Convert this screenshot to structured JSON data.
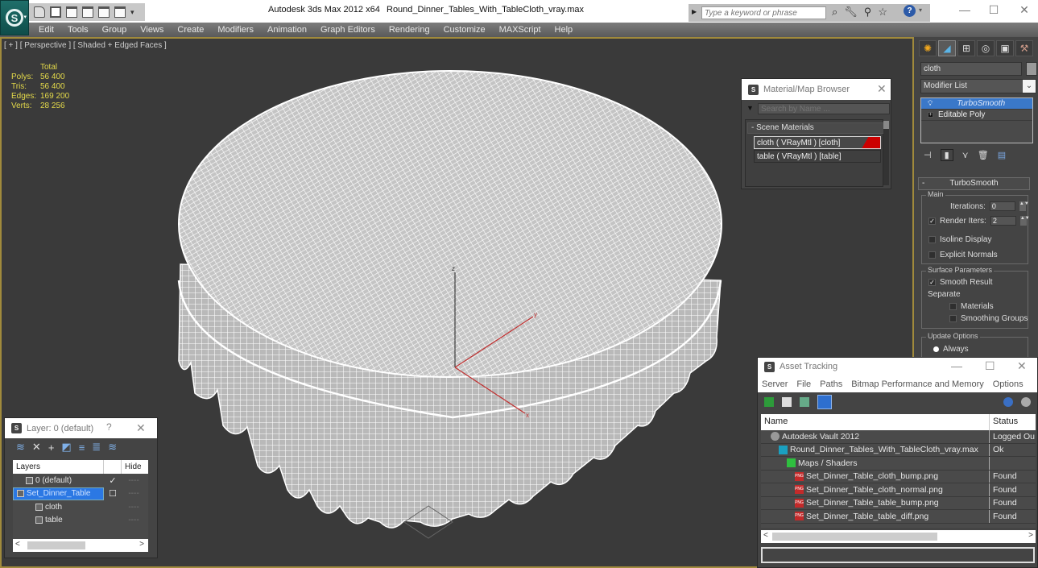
{
  "window": {
    "app_title": "Autodesk 3ds Max  2012 x64",
    "file_title": "Round_Dinner_Tables_With_TableCloth_vray.max",
    "search_placeholder": "Type a keyword or phrase",
    "app_button_icon": "3dsmax-logo-icon",
    "quick_access_icons": [
      "new-scene-icon",
      "open-file-icon",
      "save-file-icon",
      "undo-icon",
      "redo-icon",
      "project-folder-icon",
      "customize-dropdown-icon"
    ],
    "search_icons": [
      "binoculars-icon",
      "wrench-icon",
      "satellite-icon",
      "star-icon"
    ],
    "help_label": "?",
    "controls": {
      "minimize": "—",
      "maximize": "☐",
      "close": "✕"
    }
  },
  "menubar": [
    "Edit",
    "Tools",
    "Group",
    "Views",
    "Create",
    "Modifiers",
    "Animation",
    "Graph Editors",
    "Rendering",
    "Customize",
    "MAXScript",
    "Help"
  ],
  "viewport": {
    "label": "[ + ] [ Perspective ] [ Shaded + Edged Faces ]",
    "stats": {
      "header": "Total",
      "rows": [
        {
          "k": "Polys:",
          "v": "56 400"
        },
        {
          "k": "Tris:",
          "v": "56 400"
        },
        {
          "k": "Edges:",
          "v": "169 200"
        },
        {
          "k": "Verts:",
          "v": "28 256"
        }
      ]
    },
    "gizmo": {
      "z": "z",
      "y": "y",
      "x": "x"
    }
  },
  "command_panel": {
    "tabs": [
      "create-icon",
      "modify-icon",
      "hierarchy-icon",
      "motion-icon",
      "display-icon",
      "utilities-icon"
    ],
    "active_tab": 1,
    "object_name": "cloth",
    "modifier_list": "Modifier List",
    "stack": [
      {
        "label": "TurboSmooth",
        "selected": true
      },
      {
        "label": "Editable Poly",
        "selected": false
      }
    ],
    "stack_tools": [
      "pin-stack-icon",
      "show-end-result-icon",
      "make-unique-icon",
      "remove-modifier-icon",
      "configure-sets-icon"
    ],
    "turbosmooth": {
      "title": "TurboSmooth",
      "collapse": "-",
      "main_group": "Main",
      "iterations_label": "Iterations:",
      "iterations_value": "0",
      "render_iters_label": "Render Iters:",
      "render_iters_value": "2",
      "render_iters_checked": true,
      "isoline_label": "Isoline Display",
      "isoline_checked": false,
      "explicit_normals_label": "Explicit Normals",
      "explicit_normals_checked": false,
      "surface_group": "Surface Parameters",
      "smooth_result_label": "Smooth Result",
      "smooth_result_checked": true,
      "separate_label": "Separate",
      "materials_label": "Materials",
      "materials_checked": false,
      "smoothing_groups_label": "Smoothing Groups",
      "smoothing_groups_checked": false,
      "update_group": "Update Options",
      "always_label": "Always"
    }
  },
  "material_browser": {
    "title": "Material/Map Browser",
    "search_placeholder": "Search by Name ...",
    "group": "- Scene Materials",
    "items": [
      {
        "label": "cloth  ( VRayMtl ) [cloth]",
        "selected": true,
        "swatch": "#cc0000"
      },
      {
        "label": "table  ( VRayMtl ) [table]",
        "selected": false
      }
    ]
  },
  "asset_tracking": {
    "title": "Asset Tracking",
    "menu": [
      "Server",
      "File",
      "Paths",
      "Bitmap Performance and Memory",
      "Options"
    ],
    "columns": [
      "Name",
      "Status"
    ],
    "rows": [
      {
        "name": "Autodesk Vault 2012",
        "status": "Logged Ou",
        "icon": "vault",
        "indent": 1
      },
      {
        "name": "Round_Dinner_Tables_With_TableCloth_vray.max",
        "status": "Ok",
        "icon": "max",
        "indent": 2
      },
      {
        "name": "Maps / Shaders",
        "status": "",
        "icon": "maps",
        "indent": 3
      },
      {
        "name": "Set_Dinner_Table_cloth_bump.png",
        "status": "Found",
        "icon": "png",
        "indent": 4
      },
      {
        "name": "Set_Dinner_Table_cloth_normal.png",
        "status": "Found",
        "icon": "png",
        "indent": 4
      },
      {
        "name": "Set_Dinner_Table_table_bump.png",
        "status": "Found",
        "icon": "png",
        "indent": 4
      },
      {
        "name": "Set_Dinner_Table_table_diff.png",
        "status": "Found",
        "icon": "png",
        "indent": 4
      }
    ],
    "png_badge": "PNG"
  },
  "layer_manager": {
    "title": "Layer: 0 (default)",
    "help": "?",
    "close": "✕",
    "toolbar": [
      "create-layer-icon",
      "delete-layer-icon",
      "add-to-layer-icon",
      "select-objects-icon",
      "highlight-layer-icon",
      "hide-all-icon",
      "freeze-all-icon"
    ],
    "columns": [
      "Layers",
      "",
      "Hide"
    ],
    "rows": [
      {
        "name": "0 (default)",
        "current": "✓",
        "hide": "----",
        "selected": false,
        "indent": 1
      },
      {
        "name": "Set_Dinner_Table",
        "current": "☐",
        "hide": "----",
        "selected": true,
        "indent": 0
      },
      {
        "name": "cloth",
        "current": "",
        "hide": "----",
        "selected": false,
        "indent": 2
      },
      {
        "name": "table",
        "current": "",
        "hide": "----",
        "selected": false,
        "indent": 2
      }
    ]
  },
  "colors": {
    "viewport_bg": "#3a3a3a",
    "viewport_border": "#a08a3c",
    "stats_text": "#e3d94a",
    "selection_blue": "#3a78c9",
    "wireframe": "#ffffff"
  }
}
